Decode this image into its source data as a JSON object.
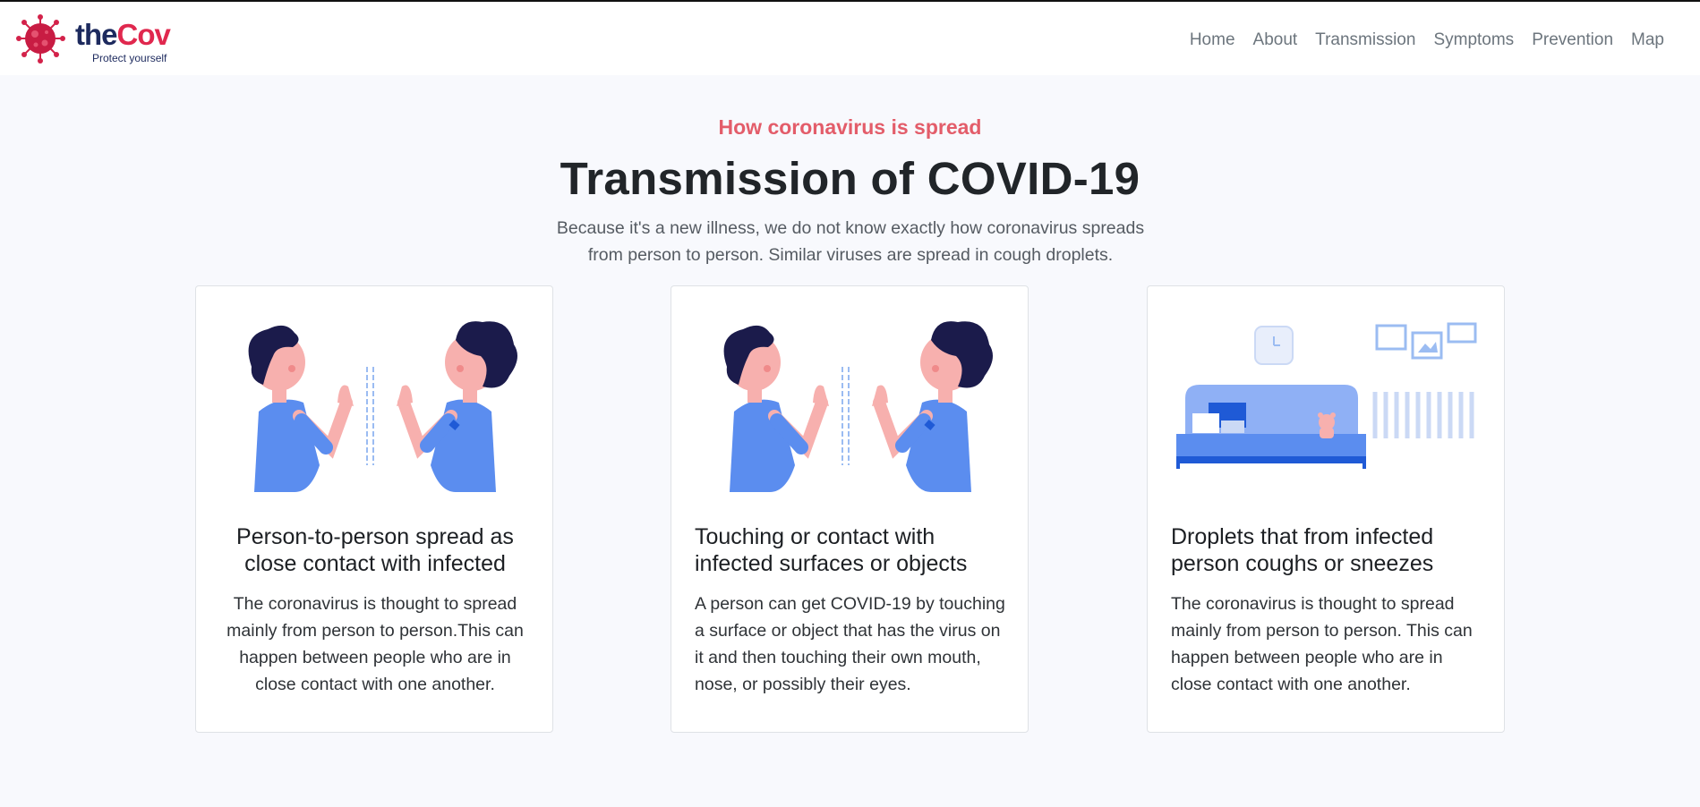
{
  "brand": {
    "name_part1": "the",
    "name_part2": "Cov",
    "tagline": "Protect yourself",
    "colors": {
      "dark": "#1d2a5e",
      "accent": "#e0284e"
    }
  },
  "nav": {
    "items": [
      {
        "label": "Home"
      },
      {
        "label": "About"
      },
      {
        "label": "Transmission"
      },
      {
        "label": "Symptoms"
      },
      {
        "label": "Prevention"
      },
      {
        "label": "Map"
      }
    ]
  },
  "section": {
    "eyebrow": "How coronavirus is spread",
    "title": "Transmission of COVID-19",
    "subtitle_line1": "Because it's a new illness, we do not know exactly how coronavirus spreads",
    "subtitle_line2": "from person to person. Similar viruses are spread in cough droplets."
  },
  "cards": [
    {
      "illustration": "two-people-high-five-illustration",
      "title": "Person-to-person spread as close contact with infected",
      "text": "The coronavirus is thought to spread mainly from person to person.This can happen between people who are in close contact with one another."
    },
    {
      "illustration": "two-people-high-five-illustration",
      "title": "Touching or contact with infected surfaces or objects",
      "text": "A person can get COVID-19 by touching a surface or object that has the virus on it and then touching their own mouth, nose, or possibly their eyes."
    },
    {
      "illustration": "bedroom-illustration",
      "title": "Droplets that from infected person coughs or sneezes",
      "text": "The coronavirus is thought to spread mainly from person to person. This can happen between people who are in close contact with one another."
    }
  ],
  "colors": {
    "eyebrow": "#e35d6a",
    "page_bg": "#f8f9fd",
    "illustration_blue": "#5b8def",
    "illustration_hair": "#1b1b4b",
    "illustration_skin": "#f7b0ae"
  }
}
